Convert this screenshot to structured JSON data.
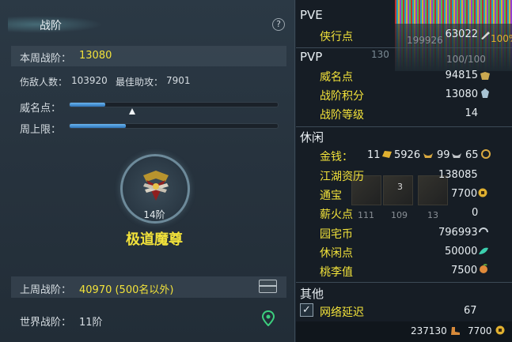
{
  "left": {
    "title": "战阶",
    "help": "?",
    "week_rank_label": "本周战阶：",
    "week_rank_value": "13080",
    "kills_label": "伤敌人数：",
    "kills_value": "103920",
    "best_assist_label": "最佳助攻：",
    "best_assist_value": "7901",
    "prestige_label": "威名点：",
    "prestige_fill": 0.17,
    "prestige_marker": 0.3,
    "weekly_cap_label": "周上限：",
    "weekly_cap_fill": 0.27,
    "rank_level": "14阶",
    "rank_name": "极道魔尊",
    "last_week_label": "上周战阶：",
    "last_week_value": "40970 (500名以外)",
    "world_rank_label": "世界战阶：",
    "world_rank_value": "11阶"
  },
  "right": {
    "pve": {
      "heading": "PVE",
      "items": [
        {
          "label": "侠行点",
          "value": "63022"
        }
      ],
      "overlay_nums": [
        "199926",
        "100%"
      ]
    },
    "pvp": {
      "heading": "PVP",
      "overlay_nums": [
        "130",
        "100/100"
      ],
      "items": [
        {
          "label": "威名点",
          "value": "94815"
        },
        {
          "label": "战阶积分",
          "value": "13080"
        },
        {
          "label": "战阶等级",
          "value": "14"
        }
      ]
    },
    "leisure": {
      "heading": "休闲",
      "money_label": "金钱：",
      "money_gold": "11",
      "money_silver": "5926",
      "money_copper1": "99",
      "money_copper2": "65",
      "items": [
        {
          "label": "江湖资历",
          "value": "138085"
        },
        {
          "label": "通宝",
          "value": "7700"
        },
        {
          "label": "薪火点",
          "value": "0"
        },
        {
          "label": "园宅币",
          "value": "796993"
        },
        {
          "label": "休闲点",
          "value": "50000"
        },
        {
          "label": "桃李值",
          "value": "7500"
        }
      ],
      "tile_nums": [
        "3",
        "111",
        "109",
        "13"
      ]
    },
    "other": {
      "heading": "其他",
      "items": [
        {
          "label": "网络延迟",
          "value": "67"
        }
      ]
    },
    "footer": {
      "left_value": "237130",
      "right_value": "7700"
    }
  },
  "colors": {
    "accent_yellow": "#f2e23a",
    "bar_blue": "#4a97d8"
  }
}
